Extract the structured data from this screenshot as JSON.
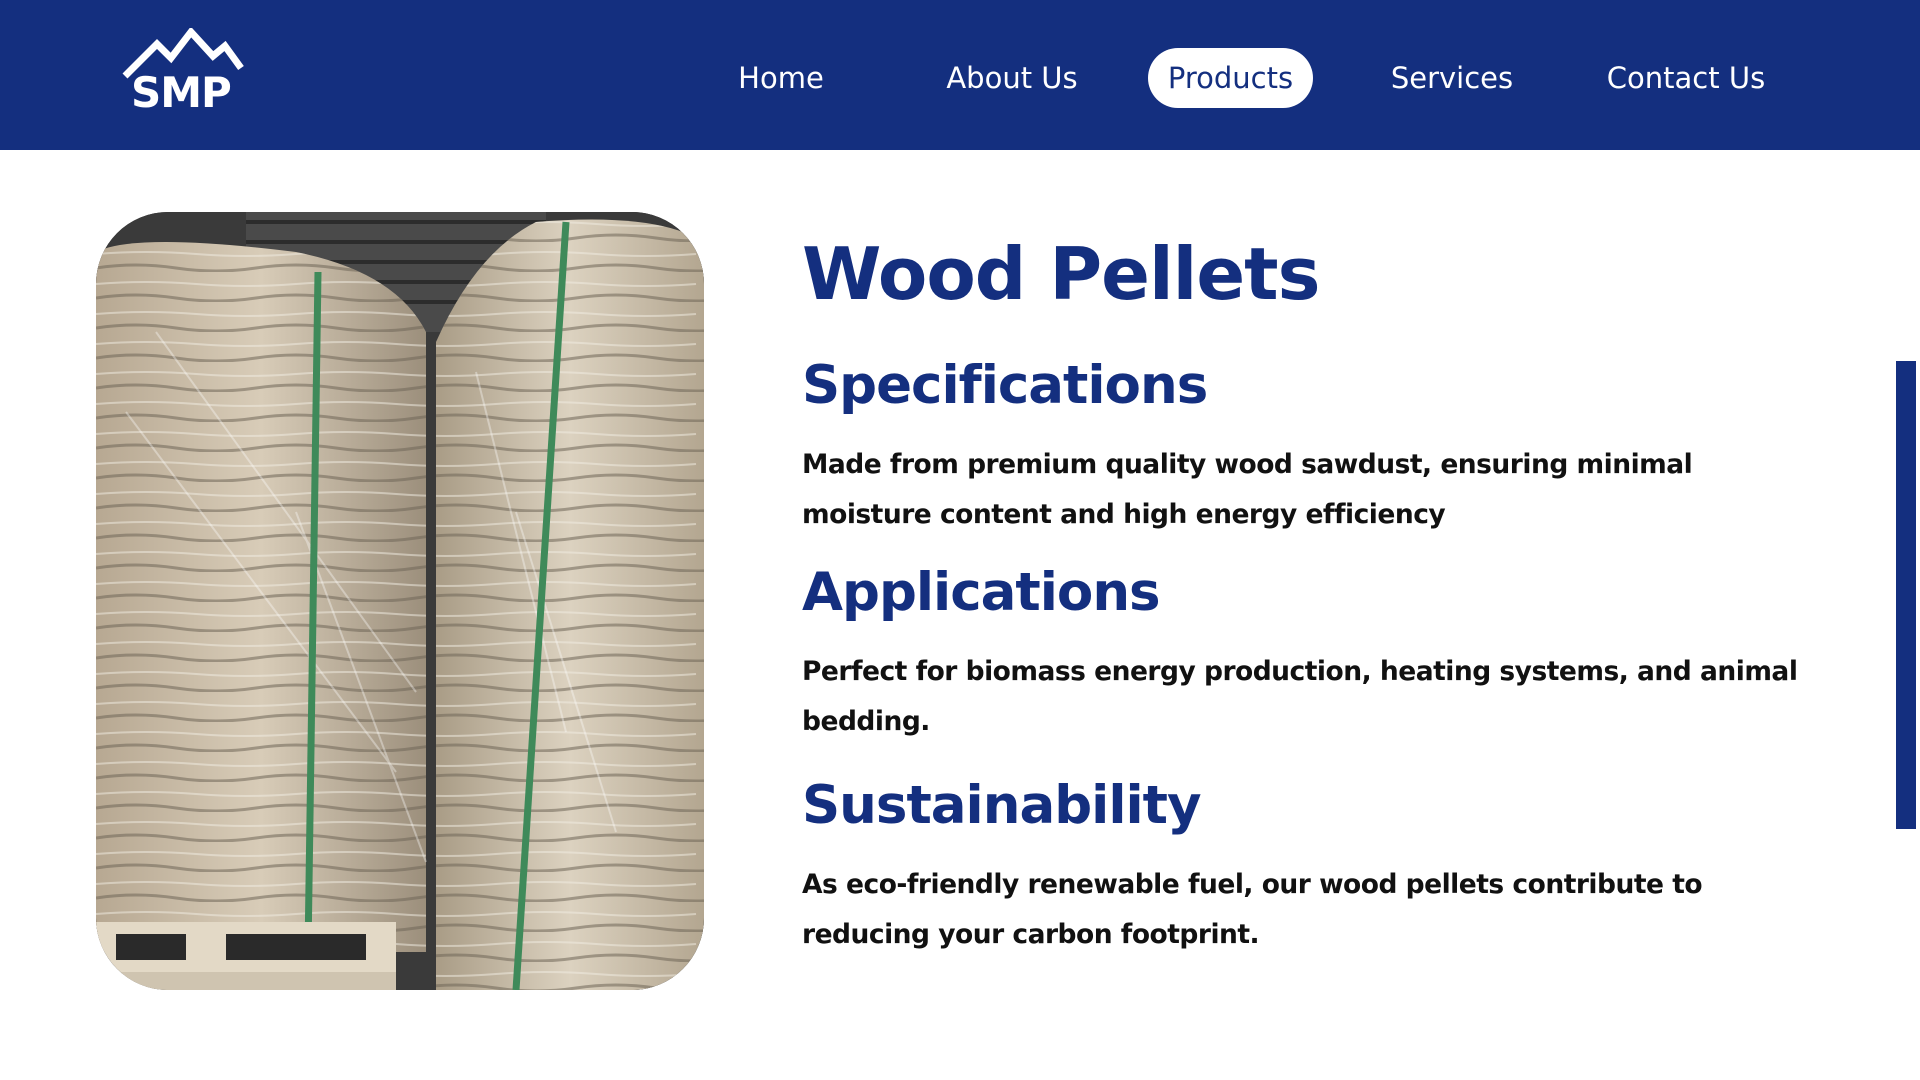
{
  "brand": {
    "logo_text": "SMP",
    "primary_color": "#142f7f",
    "logo_icon": "mountain-icon"
  },
  "nav": {
    "items": [
      {
        "label": "Home",
        "active": false
      },
      {
        "label": "About Us",
        "active": false
      },
      {
        "label": "Products",
        "active": true
      },
      {
        "label": "Services",
        "active": false
      },
      {
        "label": "Contact Us",
        "active": false
      }
    ]
  },
  "product": {
    "title": "Wood Pellets",
    "sections": [
      {
        "heading": "Specifications",
        "text": "Made from premium quality wood sawdust, ensuring minimal moisture content and high energy efficiency"
      },
      {
        "heading": "Applications",
        "text": "Perfect for biomass energy production, heating systems, and animal bedding."
      },
      {
        "heading": "Sustainability",
        "text": "As eco-friendly renewable fuel, our wood pellets contribute to reducing your carbon footprint."
      }
    ]
  }
}
